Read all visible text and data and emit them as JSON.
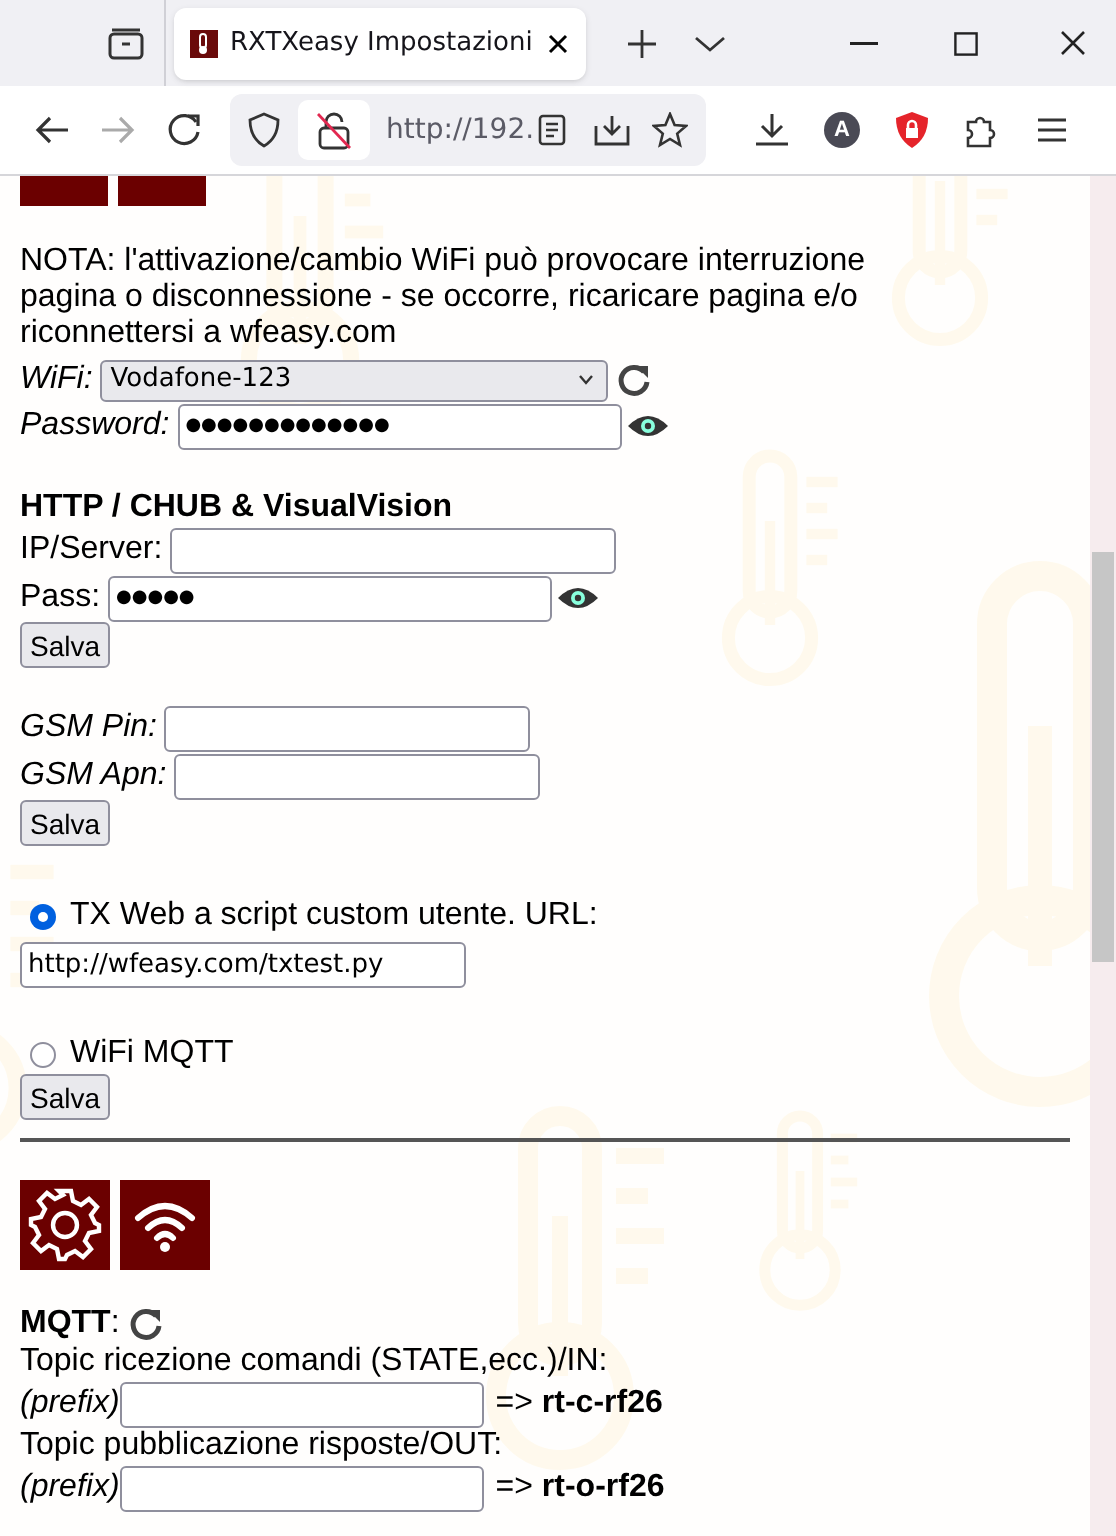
{
  "browser": {
    "tab_title": "RXTXeasy Impostazioni",
    "url": "http://192.",
    "account_initial": "A"
  },
  "note": "NOTA: l'attivazione/cambio WiFi può provocare interruzione pagina o disconnessione - se occorre, ricaricare pagina e/o riconnettersi a wfeasy.com",
  "wifi": {
    "label": "WiFi:",
    "network": "Vodafone-123",
    "password_label": "Password:",
    "password": "●●●●●●●●●●●●●"
  },
  "http": {
    "heading": "HTTP / CHUB & VisualVision",
    "ip_label": "IP/Server:",
    "pass_label": "Pass:",
    "pass": "●●●●●",
    "save": "Salva"
  },
  "gsm": {
    "pin_label": "GSM Pin:",
    "apn_label": "GSM Apn:",
    "save": "Salva"
  },
  "modes": [
    {
      "label": "TX Web a script custom utente. URL:",
      "selected": true,
      "url": "http://wfeasy.com/txtest.py"
    },
    {
      "label": "WiFi MQTT",
      "selected": false
    }
  ],
  "modes_save": "Salva",
  "mqtt": {
    "label": "**MQTT**:",
    "topics": [
      {
        "label": "Topic ricezione comandi (STATE,ecc.)/IN:",
        "prefix_label": "(prefix)",
        "result": "=> **rt-c-rf26**"
      },
      {
        "label": "Topic pubblicazione risposte/OUT:",
        "prefix_label": "(prefix)",
        "result": "=> **rt-o-rf26**"
      }
    ]
  }
}
